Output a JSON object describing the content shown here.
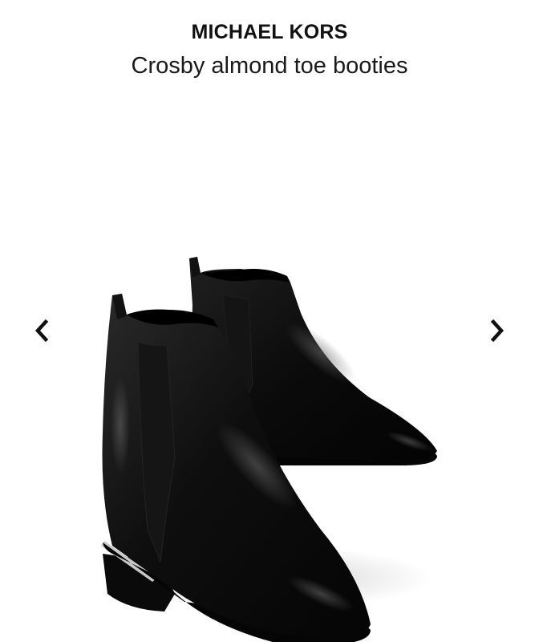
{
  "product": {
    "brand": "MICHAEL KORS",
    "name": "Crosby almond toe booties"
  },
  "carousel": {
    "image_subject": "pair of black leather ankle booties",
    "prev_icon": "chevron-left-icon",
    "next_icon": "chevron-right-icon"
  },
  "colors": {
    "text": "#111111",
    "background": "#ffffff",
    "leather": "#0d0d0d",
    "heel_trim": "#c8c8c8"
  }
}
